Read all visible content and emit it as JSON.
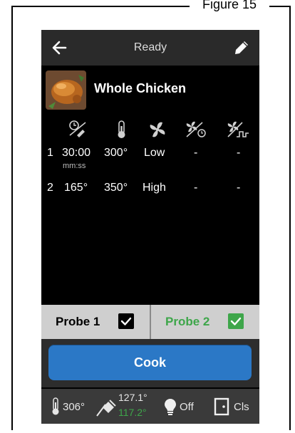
{
  "figure": {
    "label": "Figure 15"
  },
  "header": {
    "title": "Ready",
    "back_icon": "arrow-left-icon",
    "edit_icon": "pencil-icon"
  },
  "recipe": {
    "name": "Whole Chicken",
    "thumbnail": "roast-chicken-image"
  },
  "columns": [
    {
      "icon": "timer-probe-icon"
    },
    {
      "icon": "thermometer-icon"
    },
    {
      "icon": "fan-icon"
    },
    {
      "icon": "fan-timer-icon"
    },
    {
      "icon": "fan-pulse-icon"
    }
  ],
  "steps": [
    {
      "index": "1",
      "time": "30:00",
      "time_unit": "mm:ss",
      "temp": "300°",
      "fan": "Low",
      "fan_timer": "-",
      "fan_pulse": "-"
    },
    {
      "index": "2",
      "time": "165°",
      "time_unit": "",
      "temp": "350°",
      "fan": "High",
      "fan_timer": "-",
      "fan_pulse": "-"
    }
  ],
  "probes": [
    {
      "label": "Probe 1",
      "checked": true,
      "color": "#000000"
    },
    {
      "label": "Probe 2",
      "checked": true,
      "color": "#3ea64a"
    }
  ],
  "actions": {
    "cook_label": "Cook"
  },
  "status": {
    "oven_temp": "306°",
    "probe_1_temp": "127.1°",
    "probe_2_temp": "117.2°",
    "light": "Off",
    "door": "Cls"
  },
  "colors": {
    "accent": "#2b78c6",
    "probe2": "#3ea64a",
    "probe2_temp": "#3ea64a"
  }
}
